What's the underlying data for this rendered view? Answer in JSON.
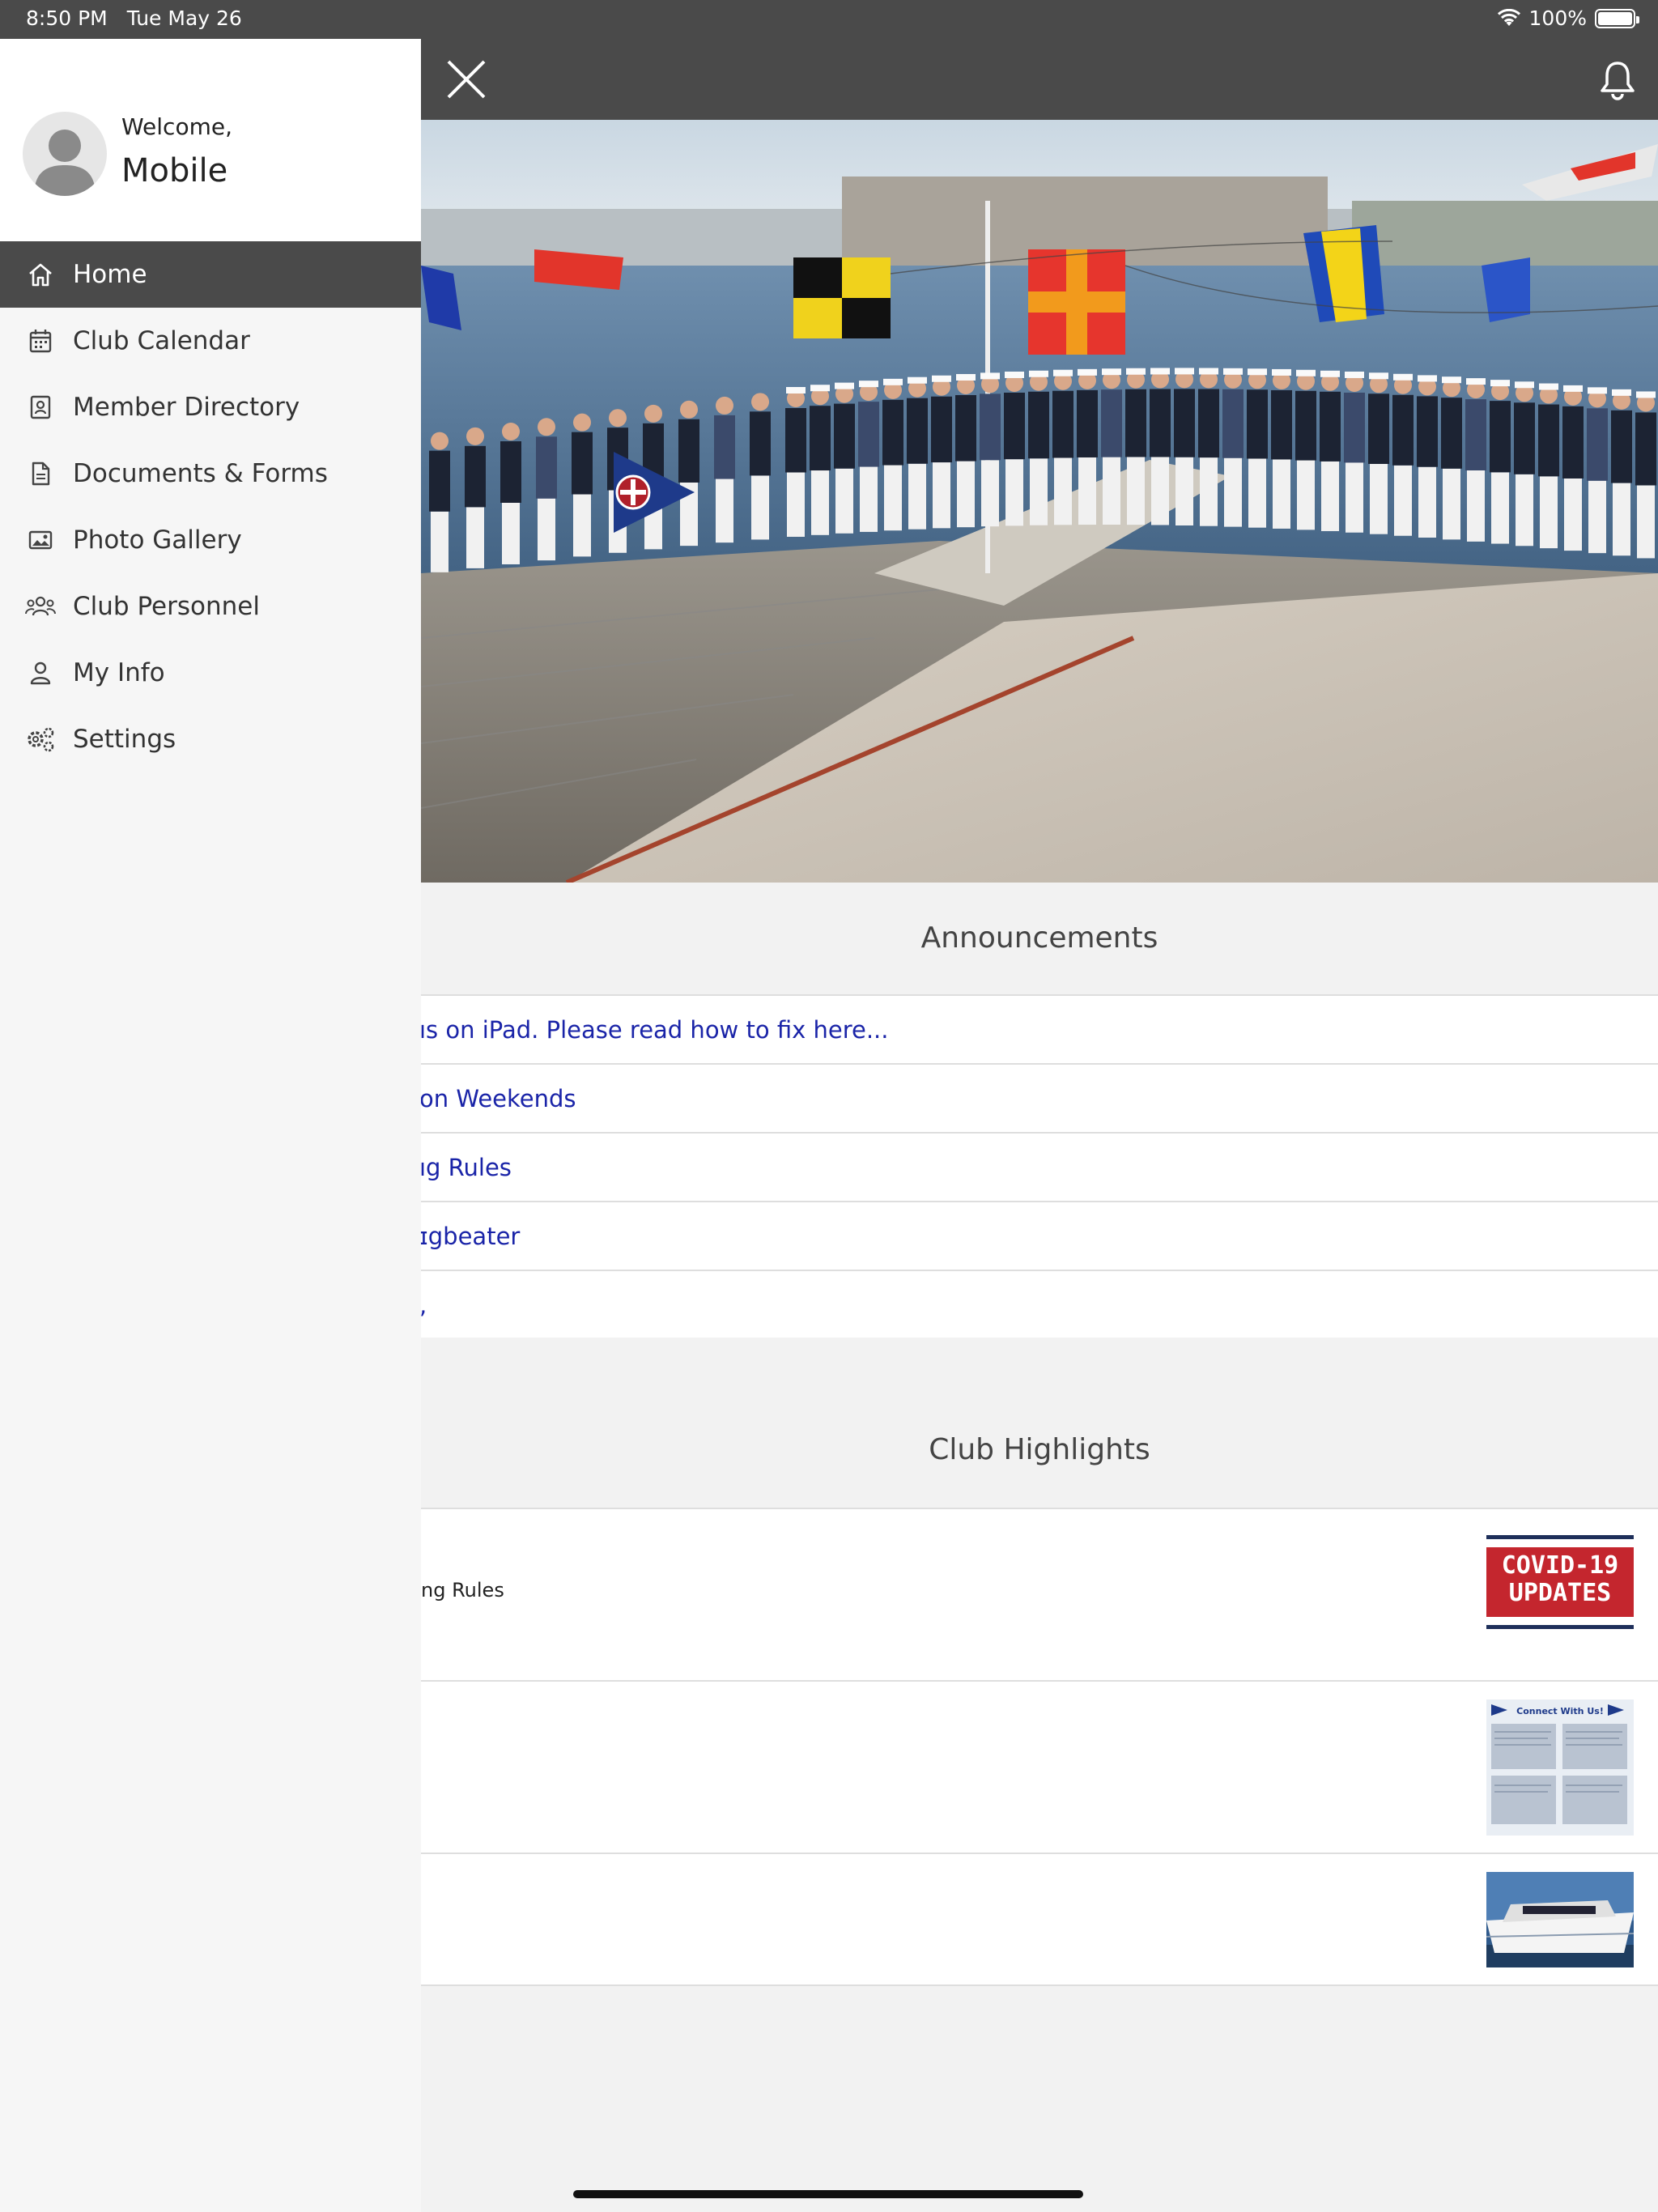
{
  "status_bar": {
    "time": "8:50 PM",
    "date": "Tue May 26",
    "battery": "100%",
    "battery_level": 1.0
  },
  "drawer": {
    "welcome": "Welcome,",
    "user_name": "Mobile",
    "menu": [
      {
        "label": "Home",
        "icon": "home-icon",
        "active": true
      },
      {
        "label": "Club Calendar",
        "icon": "calendar-icon"
      },
      {
        "label": "Member Directory",
        "icon": "directory-icon"
      },
      {
        "label": "Documents & Forms",
        "icon": "document-icon"
      },
      {
        "label": "Photo Gallery",
        "icon": "photo-icon"
      },
      {
        "label": "Club Personnel",
        "icon": "people-icon"
      },
      {
        "label": "My Info",
        "icon": "person-icon"
      },
      {
        "label": "Settings",
        "icon": "settings-icon"
      }
    ]
  },
  "announcements": {
    "title": "Announcements",
    "items": [
      "ıs on iPad. Please read how to fix here...",
      " on Weekends",
      "ıg Rules",
      "ɪgbeater",
      ","
    ]
  },
  "highlights": {
    "title": "Club Highlights",
    "items": [
      {
        "title": "ng Rules",
        "thumb_text": [
          "COVID-19",
          "UPDATES"
        ]
      },
      {
        "title": "",
        "thumb_text": [
          "Connect With Us!"
        ]
      },
      {
        "title": "",
        "thumb_text": []
      }
    ]
  }
}
